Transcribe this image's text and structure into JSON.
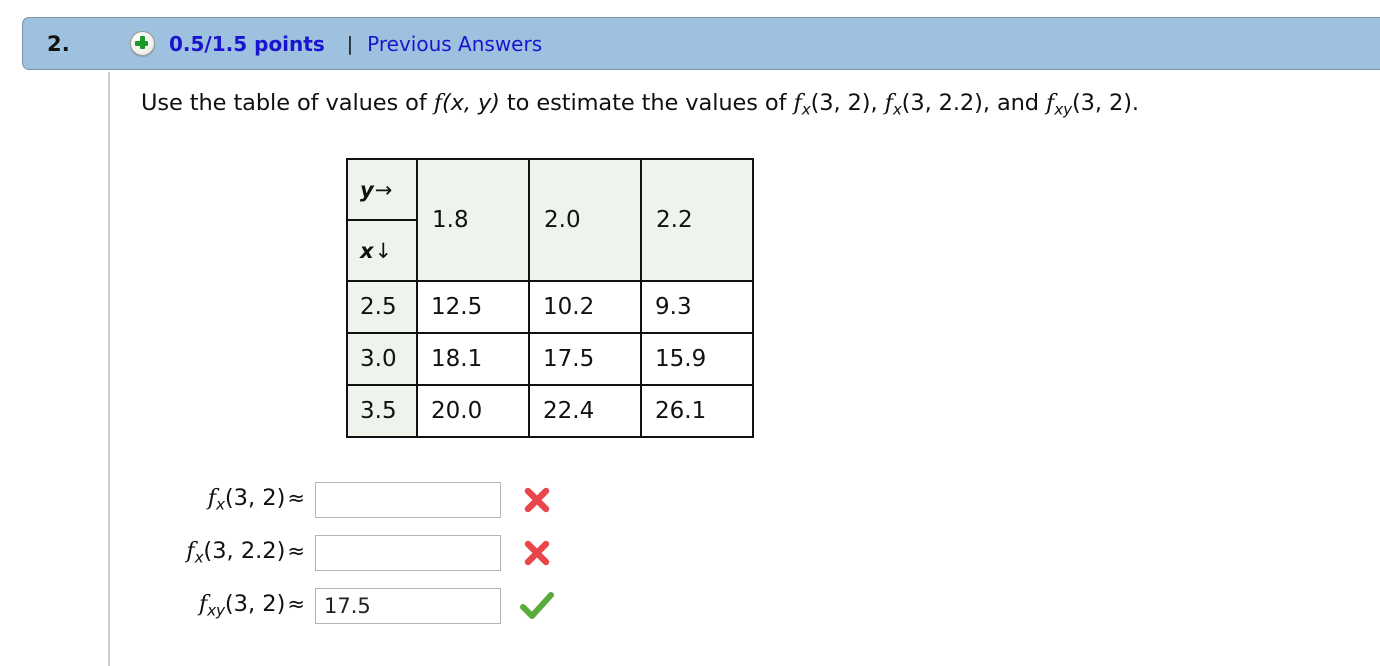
{
  "header": {
    "question_number": "2.",
    "status_icon": "plus-circle-icon",
    "points": "0.5/1.5 points",
    "separator": "|",
    "previous_answers_label": "Previous Answers",
    "bar_color": "#9dc1de",
    "link_color": "#1a14d0"
  },
  "prompt": {
    "part1": "Use the table of values of ",
    "fn_f": "f",
    "fn_args": "(x, y)",
    "part2": " to estimate the values of ",
    "t1_f": "f",
    "t1_sub": "x",
    "t1_args": "(3, 2)",
    "comma1": ", ",
    "t2_f": "f",
    "t2_sub": "x",
    "t2_args": "(3, 2.2)",
    "comma2": ", and ",
    "t3_f": "f",
    "t3_sub": "xy",
    "t3_args": "(3, 2)",
    "period": "."
  },
  "table": {
    "corner_y_label": "y",
    "corner_y_arrow": "→",
    "corner_x_label": "x",
    "corner_x_arrow": "↓",
    "column_headers": [
      "1.8",
      "2.0",
      "2.2"
    ],
    "rows": [
      {
        "row_header": "2.5",
        "values": [
          "12.5",
          "10.2",
          "9.3"
        ]
      },
      {
        "row_header": "3.0",
        "values": [
          "18.1",
          "17.5",
          "15.9"
        ]
      },
      {
        "row_header": "3.5",
        "values": [
          "20.0",
          "22.4",
          "26.1"
        ]
      }
    ],
    "header_bg": "#eef4ec",
    "cell_bg": "#ffffff",
    "border_color": "#111111"
  },
  "answers": [
    {
      "f": "f",
      "sub": "x",
      "args": "(3, 2)",
      "approx": "≈",
      "value": "",
      "mark": "cross-icon",
      "mark_color": "#e8464a"
    },
    {
      "f": "f",
      "sub": "x",
      "args": "(3, 2.2)",
      "approx": "≈",
      "value": "",
      "mark": "cross-icon",
      "mark_color": "#e8464a"
    },
    {
      "f": "f",
      "sub": "xy",
      "args": "(3, 2)",
      "approx": "≈",
      "value": "17.5",
      "mark": "check-icon",
      "mark_color": "#5aab3c"
    }
  ]
}
